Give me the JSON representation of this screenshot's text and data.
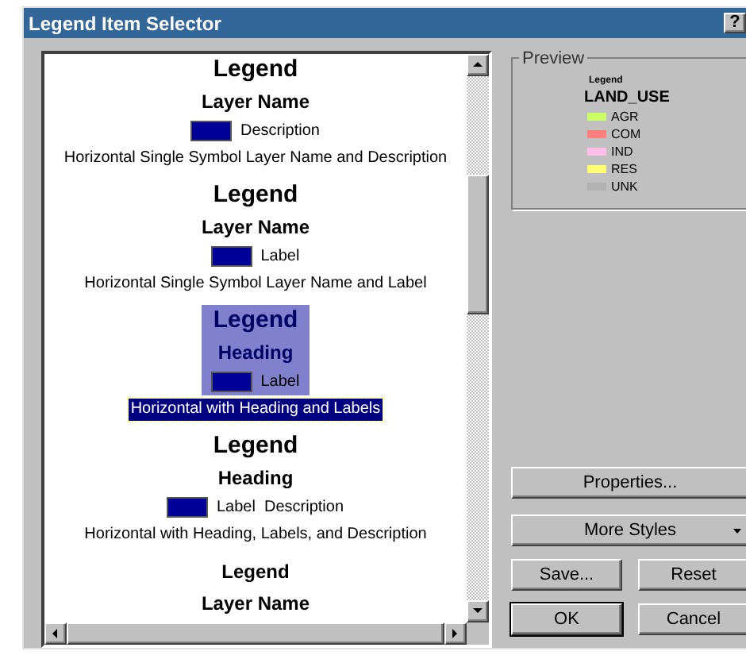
{
  "window": {
    "title": "Legend Item Selector",
    "help_button": "?"
  },
  "styles": [
    {
      "title": "Legend",
      "heading": "Layer Name",
      "swatch_text": "Description",
      "caption": "Horizontal Single Symbol Layer Name and Description",
      "selected": false
    },
    {
      "title": "Legend",
      "heading": "Layer Name",
      "swatch_text": "Label",
      "caption": "Horizontal Single Symbol Layer Name and Label",
      "selected": false
    },
    {
      "title": "Legend",
      "heading": "Heading",
      "swatch_text": "Label",
      "caption": "Horizontal with Heading and Labels",
      "selected": true
    },
    {
      "title": "Legend",
      "heading": "Heading",
      "swatch_text": "Label  Description",
      "caption": "Horizontal with Heading, Labels, and Description",
      "selected": false
    },
    {
      "title": "Legend",
      "heading": "Layer Name",
      "selected": false
    }
  ],
  "preview": {
    "label": "Preview",
    "title": "Legend",
    "layer": "LAND_USE",
    "items": [
      {
        "label": "AGR",
        "color": "#ccff66"
      },
      {
        "label": "COM",
        "color": "#ff7f7f"
      },
      {
        "label": "IND",
        "color": "#ffbfe8"
      },
      {
        "label": "RES",
        "color": "#ffff73"
      },
      {
        "label": "UNK",
        "color": "#b2b2b2"
      }
    ]
  },
  "buttons": {
    "properties": "Properties...",
    "more_styles": "More Styles",
    "save": "Save...",
    "reset": "Reset",
    "ok": "OK",
    "cancel": "Cancel"
  }
}
